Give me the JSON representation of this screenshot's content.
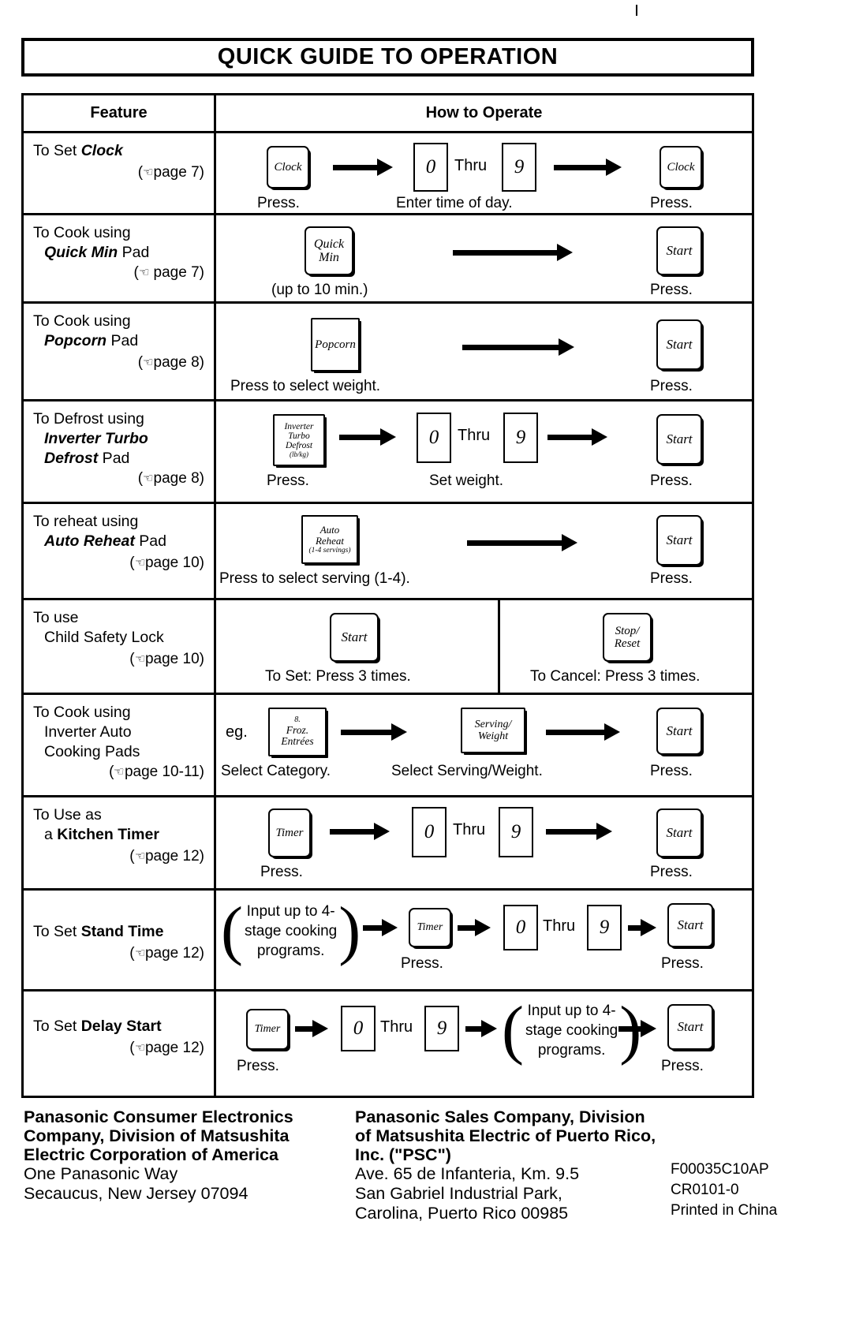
{
  "document": {
    "title": "QUICK GUIDE TO OPERATION",
    "columns": {
      "feature": "Feature",
      "how_to_operate": "How to Operate"
    }
  },
  "rows": [
    {
      "feature": {
        "line1": "To Set ",
        "line1_em": "Clock",
        "line2": "",
        "line3": "",
        "page_ref": "page 7"
      },
      "steps": {
        "pad1": "Clock",
        "pad1_caption": "Press.",
        "digit_from": "0",
        "thru": "Thru",
        "digit_to": "9",
        "digits_caption": "Enter time of day.",
        "pad_last": "Clock",
        "pad_last_caption": "Press."
      }
    },
    {
      "feature": {
        "line1": "To Cook using",
        "line2_em": "Quick Min",
        "line2_rest": " Pad",
        "page_ref": "page 7"
      },
      "steps": {
        "pad1_l1": "Quick",
        "pad1_l2": "Min",
        "pad1_caption": "(up to 10 min.)",
        "pad_last": "Start",
        "pad_last_caption": "Press."
      }
    },
    {
      "feature": {
        "line1": "To Cook using",
        "line2_em": "Popcorn",
        "line2_rest": " Pad",
        "page_ref": "page 8"
      },
      "steps": {
        "pad1": "Popcorn",
        "pad1_caption": "Press to select weight.",
        "pad_last": "Start",
        "pad_last_caption": "Press."
      }
    },
    {
      "feature": {
        "line1": "To Defrost using",
        "line2_em": "Inverter Turbo",
        "line3_em": "Defrost",
        "line3_rest": " Pad",
        "page_ref": "page 8"
      },
      "steps": {
        "pad1_l1": "Inverter",
        "pad1_l2": "Turbo",
        "pad1_l3": "Defrost",
        "pad1_l4": "(lb/kg)",
        "pad1_caption": "Press.",
        "digit_from": "0",
        "thru": "Thru",
        "digit_to": "9",
        "digits_caption": "Set weight.",
        "pad_last": "Start",
        "pad_last_caption": "Press."
      }
    },
    {
      "feature": {
        "line1": "To reheat using",
        "line2_em": "Auto Reheat",
        "line2_rest": " Pad",
        "page_ref": "page 10"
      },
      "steps": {
        "pad1_l1": "Auto",
        "pad1_l2": "Reheat",
        "pad1_l3": "(1-4 servings)",
        "pad1_caption": "Press to select serving (1-4).",
        "pad_last": "Start",
        "pad_last_caption": "Press."
      }
    },
    {
      "feature": {
        "line1": "To use",
        "line2": "Child Safety Lock",
        "page_ref": "page 10"
      },
      "steps": {
        "pad_set": "Start",
        "set_caption": "To Set: Press 3 times.",
        "pad_cancel_l1": "Stop/",
        "pad_cancel_l2": "Reset",
        "cancel_caption": "To Cancel: Press 3 times."
      }
    },
    {
      "feature": {
        "line1": "To Cook using",
        "line2": "Inverter Auto",
        "line3": "Cooking Pads",
        "page_ref": "page 10-11"
      },
      "steps": {
        "eg": "eg.",
        "pad1_l1": "8.",
        "pad1_l2": "Froz.",
        "pad1_l3": "Entrées",
        "pad1_caption": "Select Category.",
        "pad2_l1": "Serving/",
        "pad2_l2": "Weight",
        "pad2_caption": "Select Serving/Weight.",
        "pad_last": "Start",
        "pad_last_caption": "Press."
      }
    },
    {
      "feature": {
        "line1": "To Use as",
        "line2": "a ",
        "line2_em": "Kitchen Timer",
        "page_ref": "page 12"
      },
      "steps": {
        "pad1": "Timer",
        "pad1_caption": "Press.",
        "digit_from": "0",
        "thru": "Thru",
        "digit_to": "9",
        "pad_last": "Start",
        "pad_last_caption": "Press."
      }
    },
    {
      "feature": {
        "line1": "To Set ",
        "line1_em": "Stand Time",
        "page_ref": "page 12"
      },
      "steps": {
        "note_l1": "Input up to 4-",
        "note_l2": "stage cooking",
        "note_l3": "programs.",
        "pad1": "Timer",
        "pad1_caption": "Press.",
        "digit_from": "0",
        "thru": "Thru",
        "digit_to": "9",
        "pad_last": "Start",
        "pad_last_caption": "Press."
      }
    },
    {
      "feature": {
        "line1": "To Set ",
        "line1_em": "Delay Start",
        "page_ref": "page 12"
      },
      "steps": {
        "pad1": "Timer",
        "pad1_caption": "Press.",
        "digit_from": "0",
        "thru": "Thru",
        "digit_to": "9",
        "note_l1": "Input up to 4-",
        "note_l2": "stage cooking",
        "note_l3": "programs.",
        "pad_last": "Start",
        "pad_last_caption": "Press."
      }
    }
  ],
  "footer": {
    "left": {
      "bold_l1": "Panasonic Consumer Electronics",
      "bold_l2": "Company, Division of Matsushita",
      "bold_l3": "Electric Corporation of America",
      "reg_l1": "One Panasonic Way",
      "reg_l2": "Secaucus, New Jersey 07094"
    },
    "middle": {
      "bold_l1": "Panasonic Sales Company, Division",
      "bold_l2": "of Matsushita Electric of Puerto Rico,",
      "bold_l3": "Inc. (\"PSC\")",
      "reg_l1": "Ave. 65 de Infanteria, Km. 9.5",
      "reg_l2": "San Gabriel Industrial Park,",
      "reg_l3": "Carolina, Puerto Rico 00985"
    },
    "codes": {
      "l1": "F00035C10AP",
      "l2": "CR0101-0",
      "l3": "Printed in China"
    }
  }
}
